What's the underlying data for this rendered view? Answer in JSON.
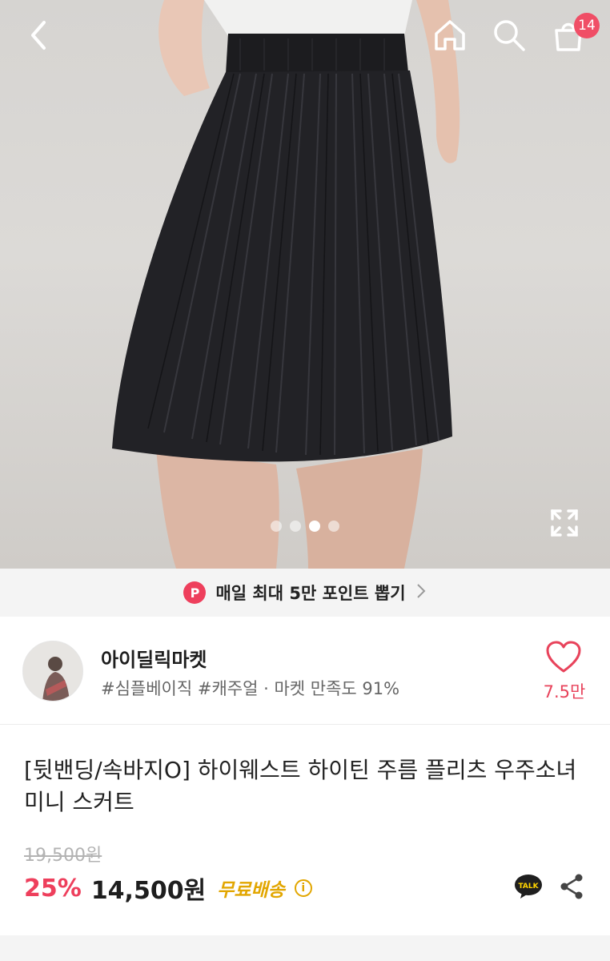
{
  "header": {
    "cart_count": "14",
    "gallery_total_dots": 4,
    "gallery_active_index": 3
  },
  "banner": {
    "icon_letter": "P",
    "text": "매일 최대 5만 포인트 뽑기"
  },
  "shop": {
    "name": "아이딜릭마켓",
    "tags": "#심플베이직 #캐주얼 · 마켓 만족도 91%",
    "likes": "7.5만"
  },
  "product": {
    "title": "[뒷밴딩/속바지O] 하이웨스트 하이틴 주름 플리츠 우주소녀 미니 스커트",
    "original_price": "19,500원",
    "discount": "25%",
    "price": "14,500원",
    "shipping": "무료배송",
    "info_symbol": "i",
    "talk_label": "TALK"
  },
  "colors": {
    "accent": "#ee3f5c",
    "shipping": "#e2a600"
  }
}
